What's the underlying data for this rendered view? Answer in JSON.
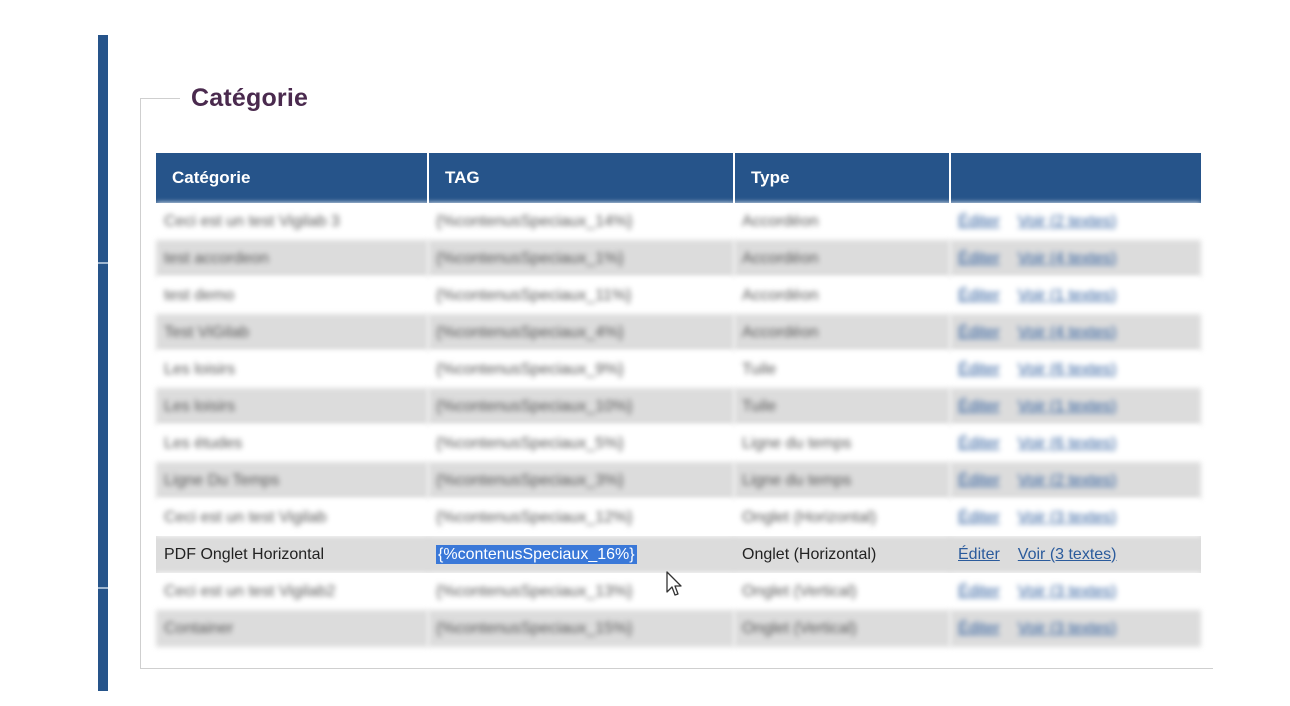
{
  "section": {
    "legend": "Catégorie"
  },
  "table": {
    "headers": [
      "Catégorie",
      "TAG",
      "Type",
      ""
    ],
    "rows": [
      {
        "category": "Ceci est un test Vigilab 3",
        "tag": "{%contenusSpeciaux_14%}",
        "type": "Accordéon",
        "edit": "Éditer",
        "view": "Voir (2 textes)",
        "blurred": true
      },
      {
        "category": "test accordeon",
        "tag": "{%contenusSpeciaux_1%}",
        "type": "Accordéon",
        "edit": "Éditer",
        "view": "Voir (4 textes)",
        "blurred": true
      },
      {
        "category": "test demo",
        "tag": "{%contenusSpeciaux_11%}",
        "type": "Accordéon",
        "edit": "Éditer",
        "view": "Voir (1 textes)",
        "blurred": true
      },
      {
        "category": "Test ViGilab",
        "tag": "{%contenusSpeciaux_4%}",
        "type": "Accordéon",
        "edit": "Éditer",
        "view": "Voir (4 textes)",
        "blurred": true
      },
      {
        "category": "Les loisirs",
        "tag": "{%contenusSpeciaux_9%}",
        "type": "Tuile",
        "edit": "Éditer",
        "view": "Voir (6 textes)",
        "blurred": true
      },
      {
        "category": "Les loisirs",
        "tag": "{%contenusSpeciaux_10%}",
        "type": "Tuile",
        "edit": "Éditer",
        "view": "Voir (1 textes)",
        "blurred": true
      },
      {
        "category": "Les études",
        "tag": "{%contenusSpeciaux_5%}",
        "type": "Ligne du temps",
        "edit": "Éditer",
        "view": "Voir (6 textes)",
        "blurred": true
      },
      {
        "category": "Ligne Du Temps",
        "tag": "{%contenusSpeciaux_3%}",
        "type": "Ligne du temps",
        "edit": "Éditer",
        "view": "Voir (2 textes)",
        "blurred": true
      },
      {
        "category": "Ceci est un test Vigilab",
        "tag": "{%contenusSpeciaux_12%}",
        "type": "Onglet (Horizontal)",
        "edit": "Éditer",
        "view": "Voir (3 textes)",
        "blurred": true
      },
      {
        "category": "PDF Onglet Horizontal",
        "tag": "{%contenusSpeciaux_16%}",
        "type": "Onglet (Horizontal)",
        "edit": "Éditer",
        "view": "Voir (3 textes)",
        "blurred": false
      },
      {
        "category": "Ceci est un test Vigilab2",
        "tag": "{%contenusSpeciaux_13%}",
        "type": "Onglet (Vertical)",
        "edit": "Éditer",
        "view": "Voir (3 textes)",
        "blurred": true
      },
      {
        "category": "Container",
        "tag": "{%contenusSpeciaux_15%}",
        "type": "Onglet (Vertical)",
        "edit": "Éditer",
        "view": "Voir (3 textes)",
        "blurred": true
      }
    ]
  },
  "colors": {
    "header_bg": "#26548a",
    "legend_text": "#4a2a4e",
    "link": "#2b5b9c",
    "selection": "#3a78d8",
    "row_alt": "#dcdcdc"
  },
  "icons": {
    "cursor": "mouse-pointer-icon"
  }
}
